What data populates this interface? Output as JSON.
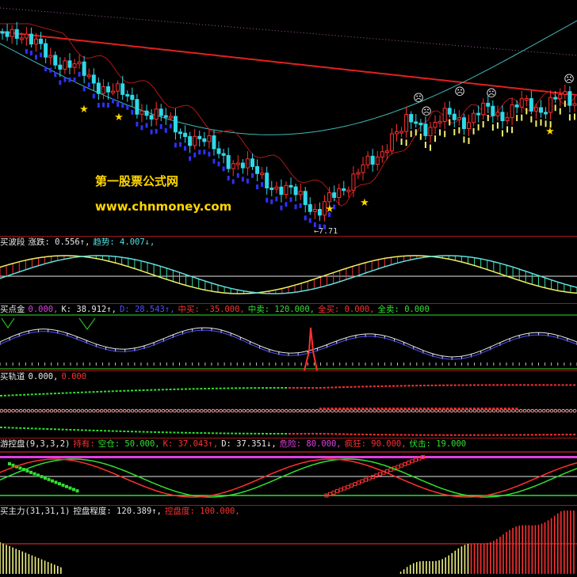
{
  "watermark": {
    "title": "第一股票公式网",
    "url": "www.chnmoney.com"
  },
  "main_chart": {
    "low_label": "←7.71"
  },
  "panels": [
    {
      "id": "wave",
      "items": [
        {
          "text": "买波段",
          "color": "#e8e8e8"
        },
        {
          "text": "涨跌: 0.556↑,",
          "color": "#e8e8e8"
        },
        {
          "text": "趋势: 4.007↓,",
          "color": "#4ee4e4"
        }
      ]
    },
    {
      "id": "point",
      "items": [
        {
          "text": "买点金",
          "color": "#e8e8e8"
        },
        {
          "text": "0.000,",
          "color": "#e040e0"
        },
        {
          "text": "K: 38.912↑,",
          "color": "#e8e8e8"
        },
        {
          "text": "D: 28.543↑,",
          "color": "#5050ff"
        },
        {
          "text": "中买: -35.000,",
          "color": "#ff3030"
        },
        {
          "text": "中卖: 120.000,",
          "color": "#30e030"
        },
        {
          "text": "全买: 0.000,",
          "color": "#ff3030"
        },
        {
          "text": "全卖: 0.000",
          "color": "#30e030"
        }
      ]
    },
    {
      "id": "track",
      "items": [
        {
          "text": "买轨道",
          "color": "#e8e8e8"
        },
        {
          "text": "0.000,",
          "color": "#e8e8e8"
        },
        {
          "text": "0.000",
          "color": "#ff3030"
        }
      ]
    },
    {
      "id": "control",
      "items": [
        {
          "text": "游控盘(9,3,3,2)",
          "color": "#e8e8e8"
        },
        {
          "text": "持有:",
          "color": "#ff3030"
        },
        {
          "text": "空仓: 50.000,",
          "color": "#30e030"
        },
        {
          "text": "K: 37.043↑,",
          "color": "#ff3030"
        },
        {
          "text": "D: 37.351↓,",
          "color": "#e8e8e8"
        },
        {
          "text": "危险: 80.000,",
          "color": "#e040e0"
        },
        {
          "text": "疯狂: 90.000,",
          "color": "#ff3030"
        },
        {
          "text": "伏击: 19.000",
          "color": "#30e030"
        }
      ]
    },
    {
      "id": "mainforce",
      "items": [
        {
          "text": "买主力(31,31,1)",
          "color": "#e8e8e8"
        },
        {
          "text": "控盘程度: 120.389↑,",
          "color": "#e8e8e8"
        },
        {
          "text": "控盘度: 100.000,",
          "color": "#ff3030"
        }
      ]
    }
  ],
  "colors": {
    "up": "#ff3030",
    "down": "#30d8e8",
    "ma_red": "#e02020",
    "ma_cyan": "#40b8b8",
    "star": "#ffd700"
  },
  "icons": [
    "star-icon",
    "smiley-icon"
  ]
}
